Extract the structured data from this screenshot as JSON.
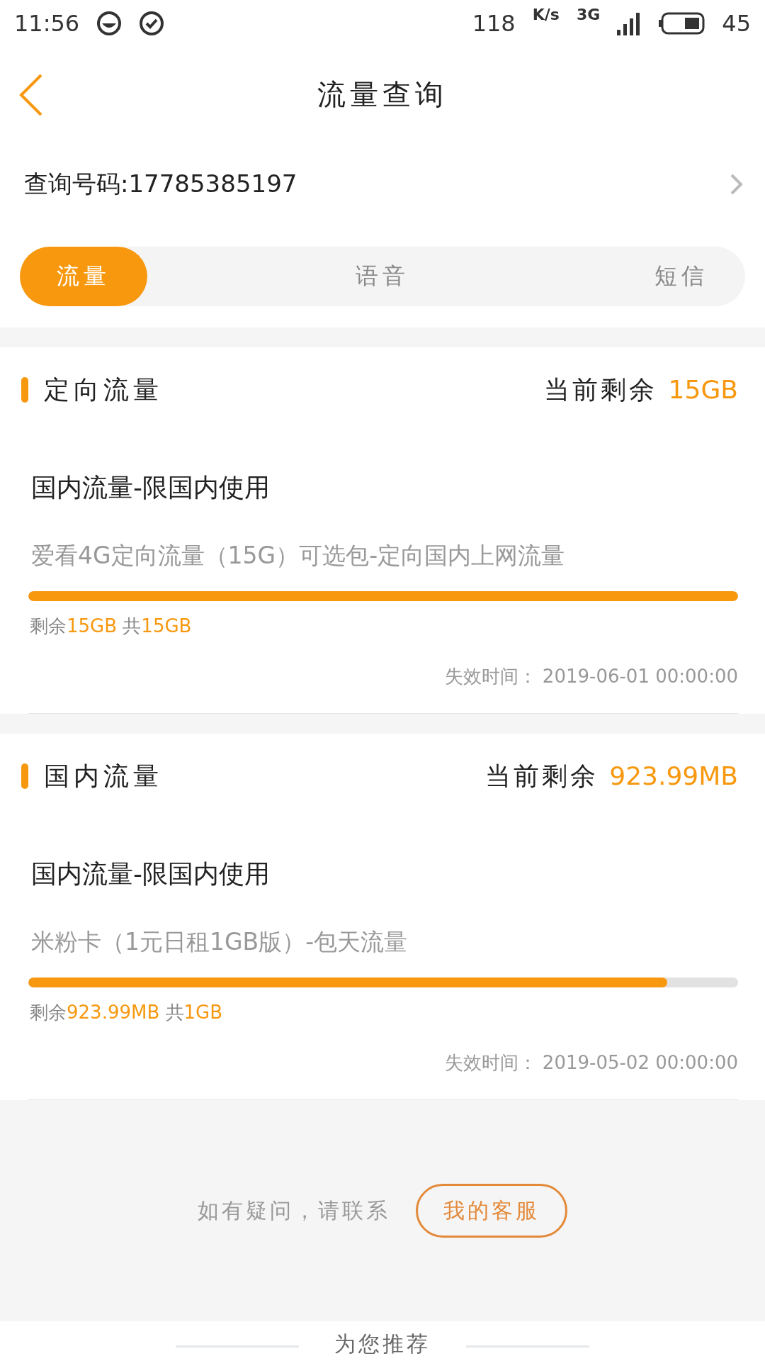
{
  "status_bar": {
    "time": "11:56",
    "speed": "118",
    "speed_unit": "K/s",
    "network": "3G",
    "battery": "45"
  },
  "header": {
    "title": "流量查询"
  },
  "query": {
    "label": "查询号码:17785385197"
  },
  "tabs": [
    {
      "label": "流量",
      "selected": true
    },
    {
      "label": "语音",
      "selected": false
    },
    {
      "label": "短信",
      "selected": false
    }
  ],
  "cards": [
    {
      "title": "定向流量",
      "remain_label": "当前剩余",
      "remain_value": "15GB",
      "item_title": "国内流量-限国内使用",
      "package": "爱看4G定向流量（15G）可选包-定向国内上网流量",
      "level": 1,
      "left_label": "剩余",
      "left_value": "15GB",
      "total_label": "共",
      "total_value": "15GB",
      "expiry": "失效时间： 2019-06-01 00:00:00"
    },
    {
      "title": "国内流量",
      "remain_label": "当前剩余",
      "remain_value": "923.99MB",
      "item_title": "国内流量-限国内使用",
      "package": "米粉卡（1元日租1GB版）-包天流量",
      "level": 0.9,
      "left_label": "剩余",
      "left_value": "923.99MB",
      "total_label": "共",
      "total_value": "1GB",
      "expiry": "失效时间： 2019-05-02 00:00:00"
    }
  ],
  "contact": {
    "text": "如有疑问，请联系",
    "button": "我的客服"
  },
  "recommend": {
    "title": "为您推荐"
  }
}
